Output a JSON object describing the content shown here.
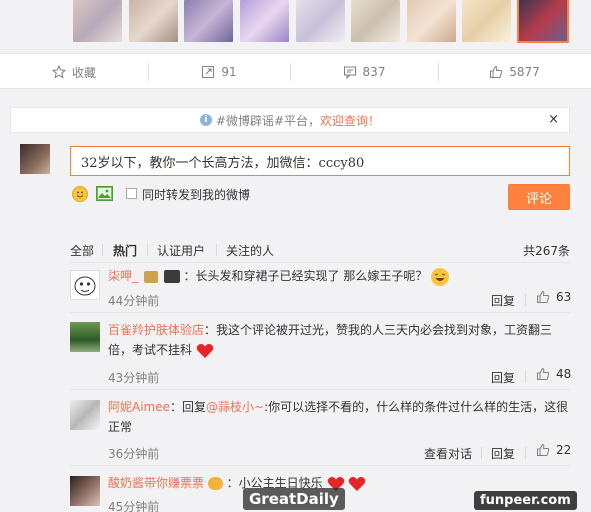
{
  "actions": {
    "favorite": "收藏",
    "repost": "91",
    "comment": "837",
    "like": "5877"
  },
  "notice": {
    "prefix": "#微博辟谣#平台，",
    "highlight": "欢迎查询！",
    "close": "×"
  },
  "composer": {
    "value": "32岁以下，教你一个长高方法，加微信：cccy80",
    "repost_label": "同时转发到我的微博",
    "submit_label": "评论"
  },
  "filters": {
    "tabs": [
      "全部",
      "热门",
      "认证用户",
      "关注的人"
    ],
    "total": "共267条"
  },
  "comments": [
    {
      "user": "柒呷_",
      "text": "：长头发和穿裙子已经实现了 那么嫁王子呢？",
      "time": "44分钟前",
      "reply": "回复",
      "likes": "63"
    },
    {
      "user": "百雀羚护肤体验店",
      "text_line1": "：我这个评论被开过光，赞我的人三天内必会找到对象，工资翻三",
      "text_line2": "倍，考试不挂科",
      "time": "43分钟前",
      "reply": "回复",
      "likes": "48"
    },
    {
      "user": "阿妮Aimee",
      "text_pre": "：回复",
      "mention": "@蒜枝小~",
      "text_line1": ":你可以选择不看的，什么样的条件过什么样的生活，这很",
      "text_line2": "正常",
      "time": "36分钟前",
      "view_conversation": "查看对话",
      "reply": "回复",
      "likes": "22"
    },
    {
      "user": "酸奶酱带你赚票票",
      "text": "：小公主生日快乐",
      "time": "45分钟前"
    }
  ],
  "watermarks": {
    "left": "GreatDaily",
    "right": "funpeer.com"
  }
}
